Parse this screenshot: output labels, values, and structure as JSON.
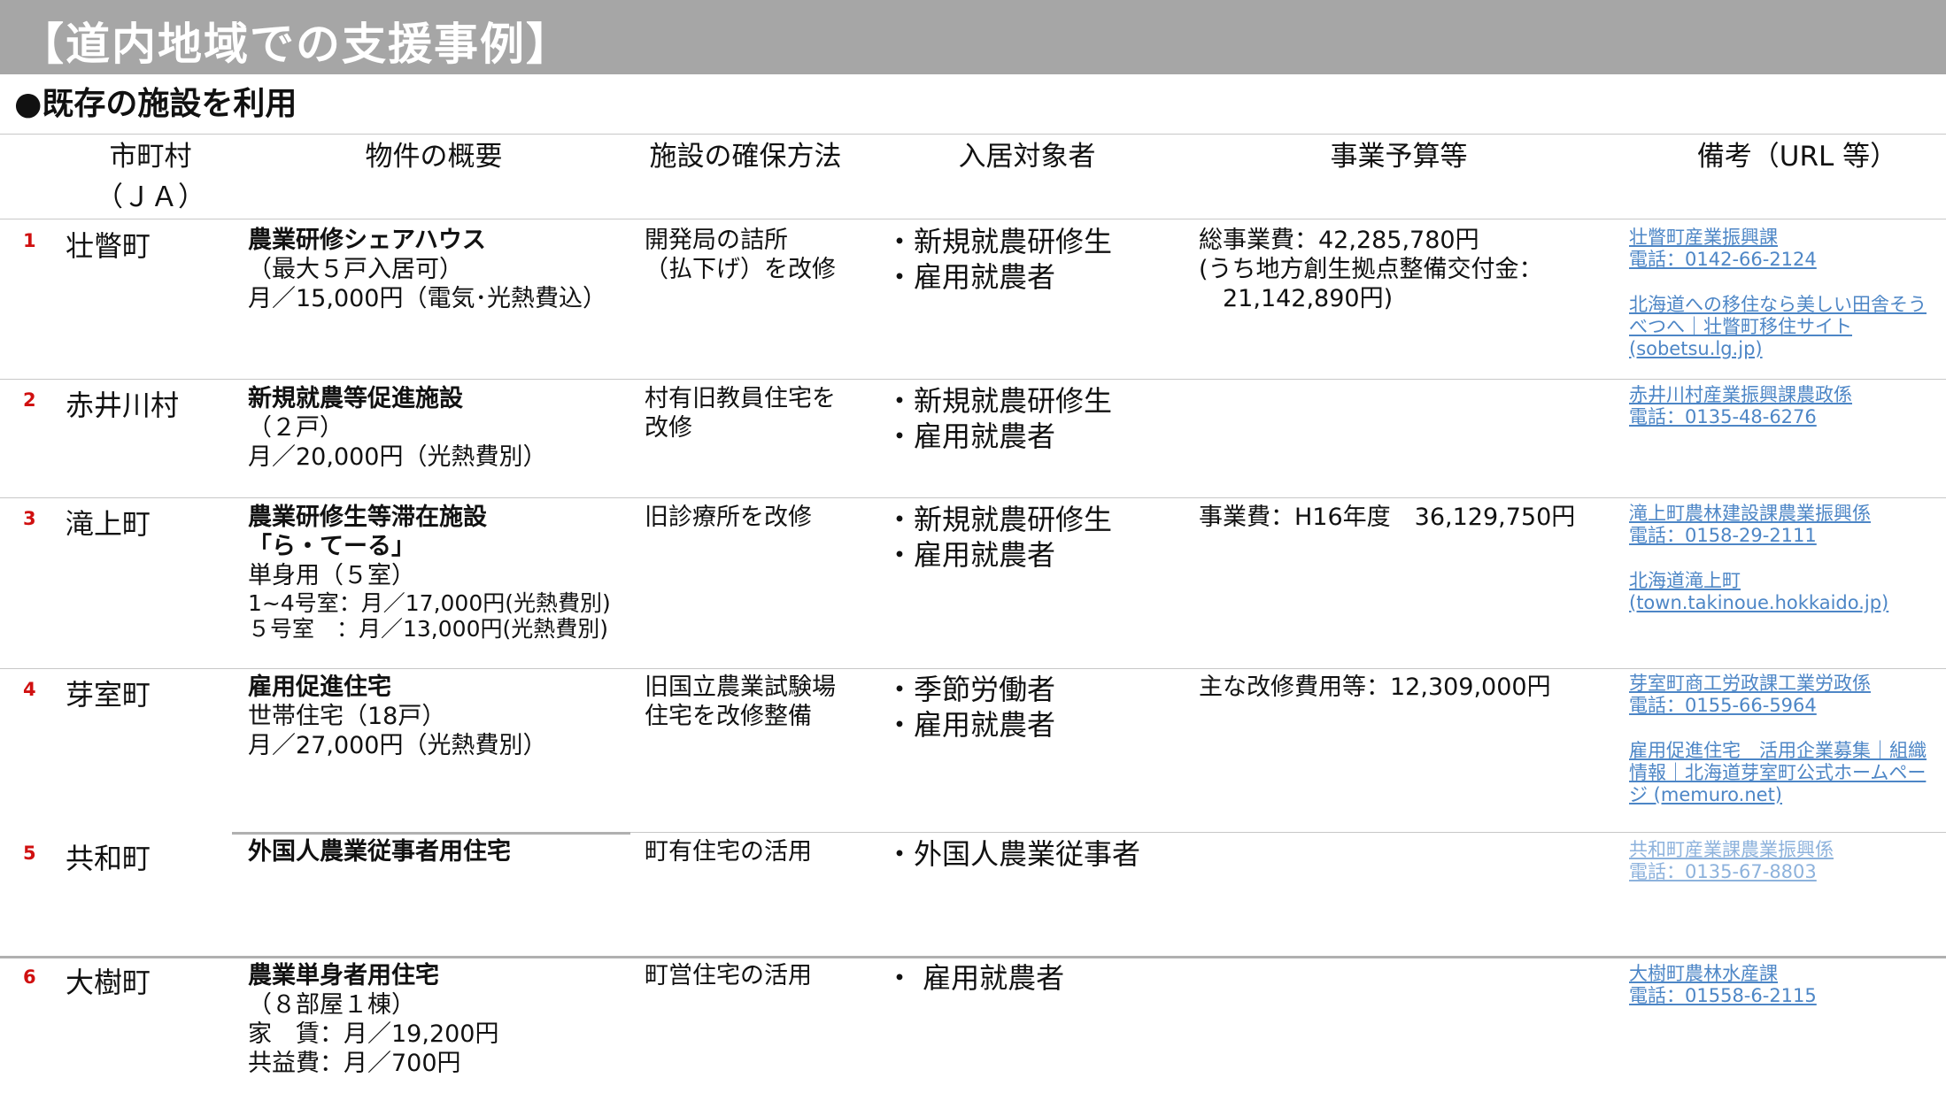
{
  "page": {
    "title": "【道内地域での支援事例】",
    "section_heading": "●既存の施設を利用"
  },
  "table": {
    "headers": {
      "municipality_line1": "市町村",
      "municipality_line2": "（ＪＡ）",
      "property": "物件の概要",
      "method": "施設の確保方法",
      "target": "入居対象者",
      "budget": "事業予算等",
      "remarks": "備考（URL 等）"
    },
    "rows": [
      {
        "num": "1",
        "municipality": "壮瞥町",
        "property": [
          "農業研修シェアハウス",
          "（最大５戸入居可）",
          "月／15,000円（電気･光熱費込）"
        ],
        "method": [
          "開発局の詰所",
          "（払下げ）を改修"
        ],
        "target": [
          "・新規就農研修生",
          "・雇用就農者"
        ],
        "budget": [
          "総事業費：42,285,780円",
          "(うち地方創生拠点整備交付金：",
          "　21,142,890円)"
        ],
        "remarks": [
          "壮瞥町産業振興課",
          "電話：0142-66-2124",
          "北海道への移住なら美しい田舎そう",
          "べつへ｜壮瞥町移住サイト",
          "(sobetsu.lg.jp)"
        ]
      },
      {
        "num": "2",
        "municipality": "赤井川村",
        "property": [
          "新規就農等促進施設",
          "（２戸）",
          "月／20,000円（光熱費別）"
        ],
        "method": [
          "村有旧教員住宅を",
          "改修"
        ],
        "target": [
          "・新規就農研修生",
          "・雇用就農者"
        ],
        "budget": [],
        "remarks": [
          "赤井川村産業振興課農政係",
          "電話：0135-48-6276"
        ]
      },
      {
        "num": "3",
        "municipality": "滝上町",
        "property": [
          "農業研修生等滞在施設",
          "「ら・てーる」",
          "単身用（５室）",
          "1~4号室：月／17,000円(光熱費別)",
          "５号室　：月／13,000円(光熱費別)"
        ],
        "method": [
          "旧診療所を改修"
        ],
        "target": [
          "・新規就農研修生",
          "・雇用就農者"
        ],
        "budget": [
          "事業費：H16年度　36,129,750円"
        ],
        "remarks": [
          "滝上町農林建設課農業振興係",
          "電話：0158-29-2111",
          "北海道滝上町",
          "(town.takinoue.hokkaido.jp)"
        ]
      },
      {
        "num": "4",
        "municipality": "芽室町",
        "property": [
          "雇用促進住宅",
          "世帯住宅（18戸）",
          "月／27,000円（光熱費別）"
        ],
        "method": [
          "旧国立農業試験場",
          "住宅を改修整備"
        ],
        "target": [
          "・季節労働者",
          "・雇用就農者"
        ],
        "budget": [
          "主な改修費用等：12,309,000円"
        ],
        "remarks": [
          "芽室町商工労政課工業労政係",
          "電話：0155-66-5964",
          "雇用促進住宅　活用企業募集｜組織",
          "情報｜北海道芽室町公式ホームペー",
          "ジ (memuro.net)"
        ]
      },
      {
        "num": "5",
        "municipality": "共和町",
        "property": [
          "外国人農業従事者用住宅"
        ],
        "method": [
          "町有住宅の活用"
        ],
        "target": [
          "・外国人農業従事者"
        ],
        "budget": [],
        "remarks": [
          "共和町産業課農業振興係",
          "電話：0135-67-8803"
        ]
      },
      {
        "num": "6",
        "municipality": "大樹町",
        "property": [
          "農業単身者用住宅",
          "（８部屋１棟）",
          "家　賃：月／19,200円",
          "共益費：月／700円"
        ],
        "method": [
          "町営住宅の活用"
        ],
        "target": [
          "・ 雇用就農者"
        ],
        "budget": [],
        "remarks": [
          "大樹町農林水産課",
          "電話：01558-6-2115"
        ]
      }
    ]
  }
}
